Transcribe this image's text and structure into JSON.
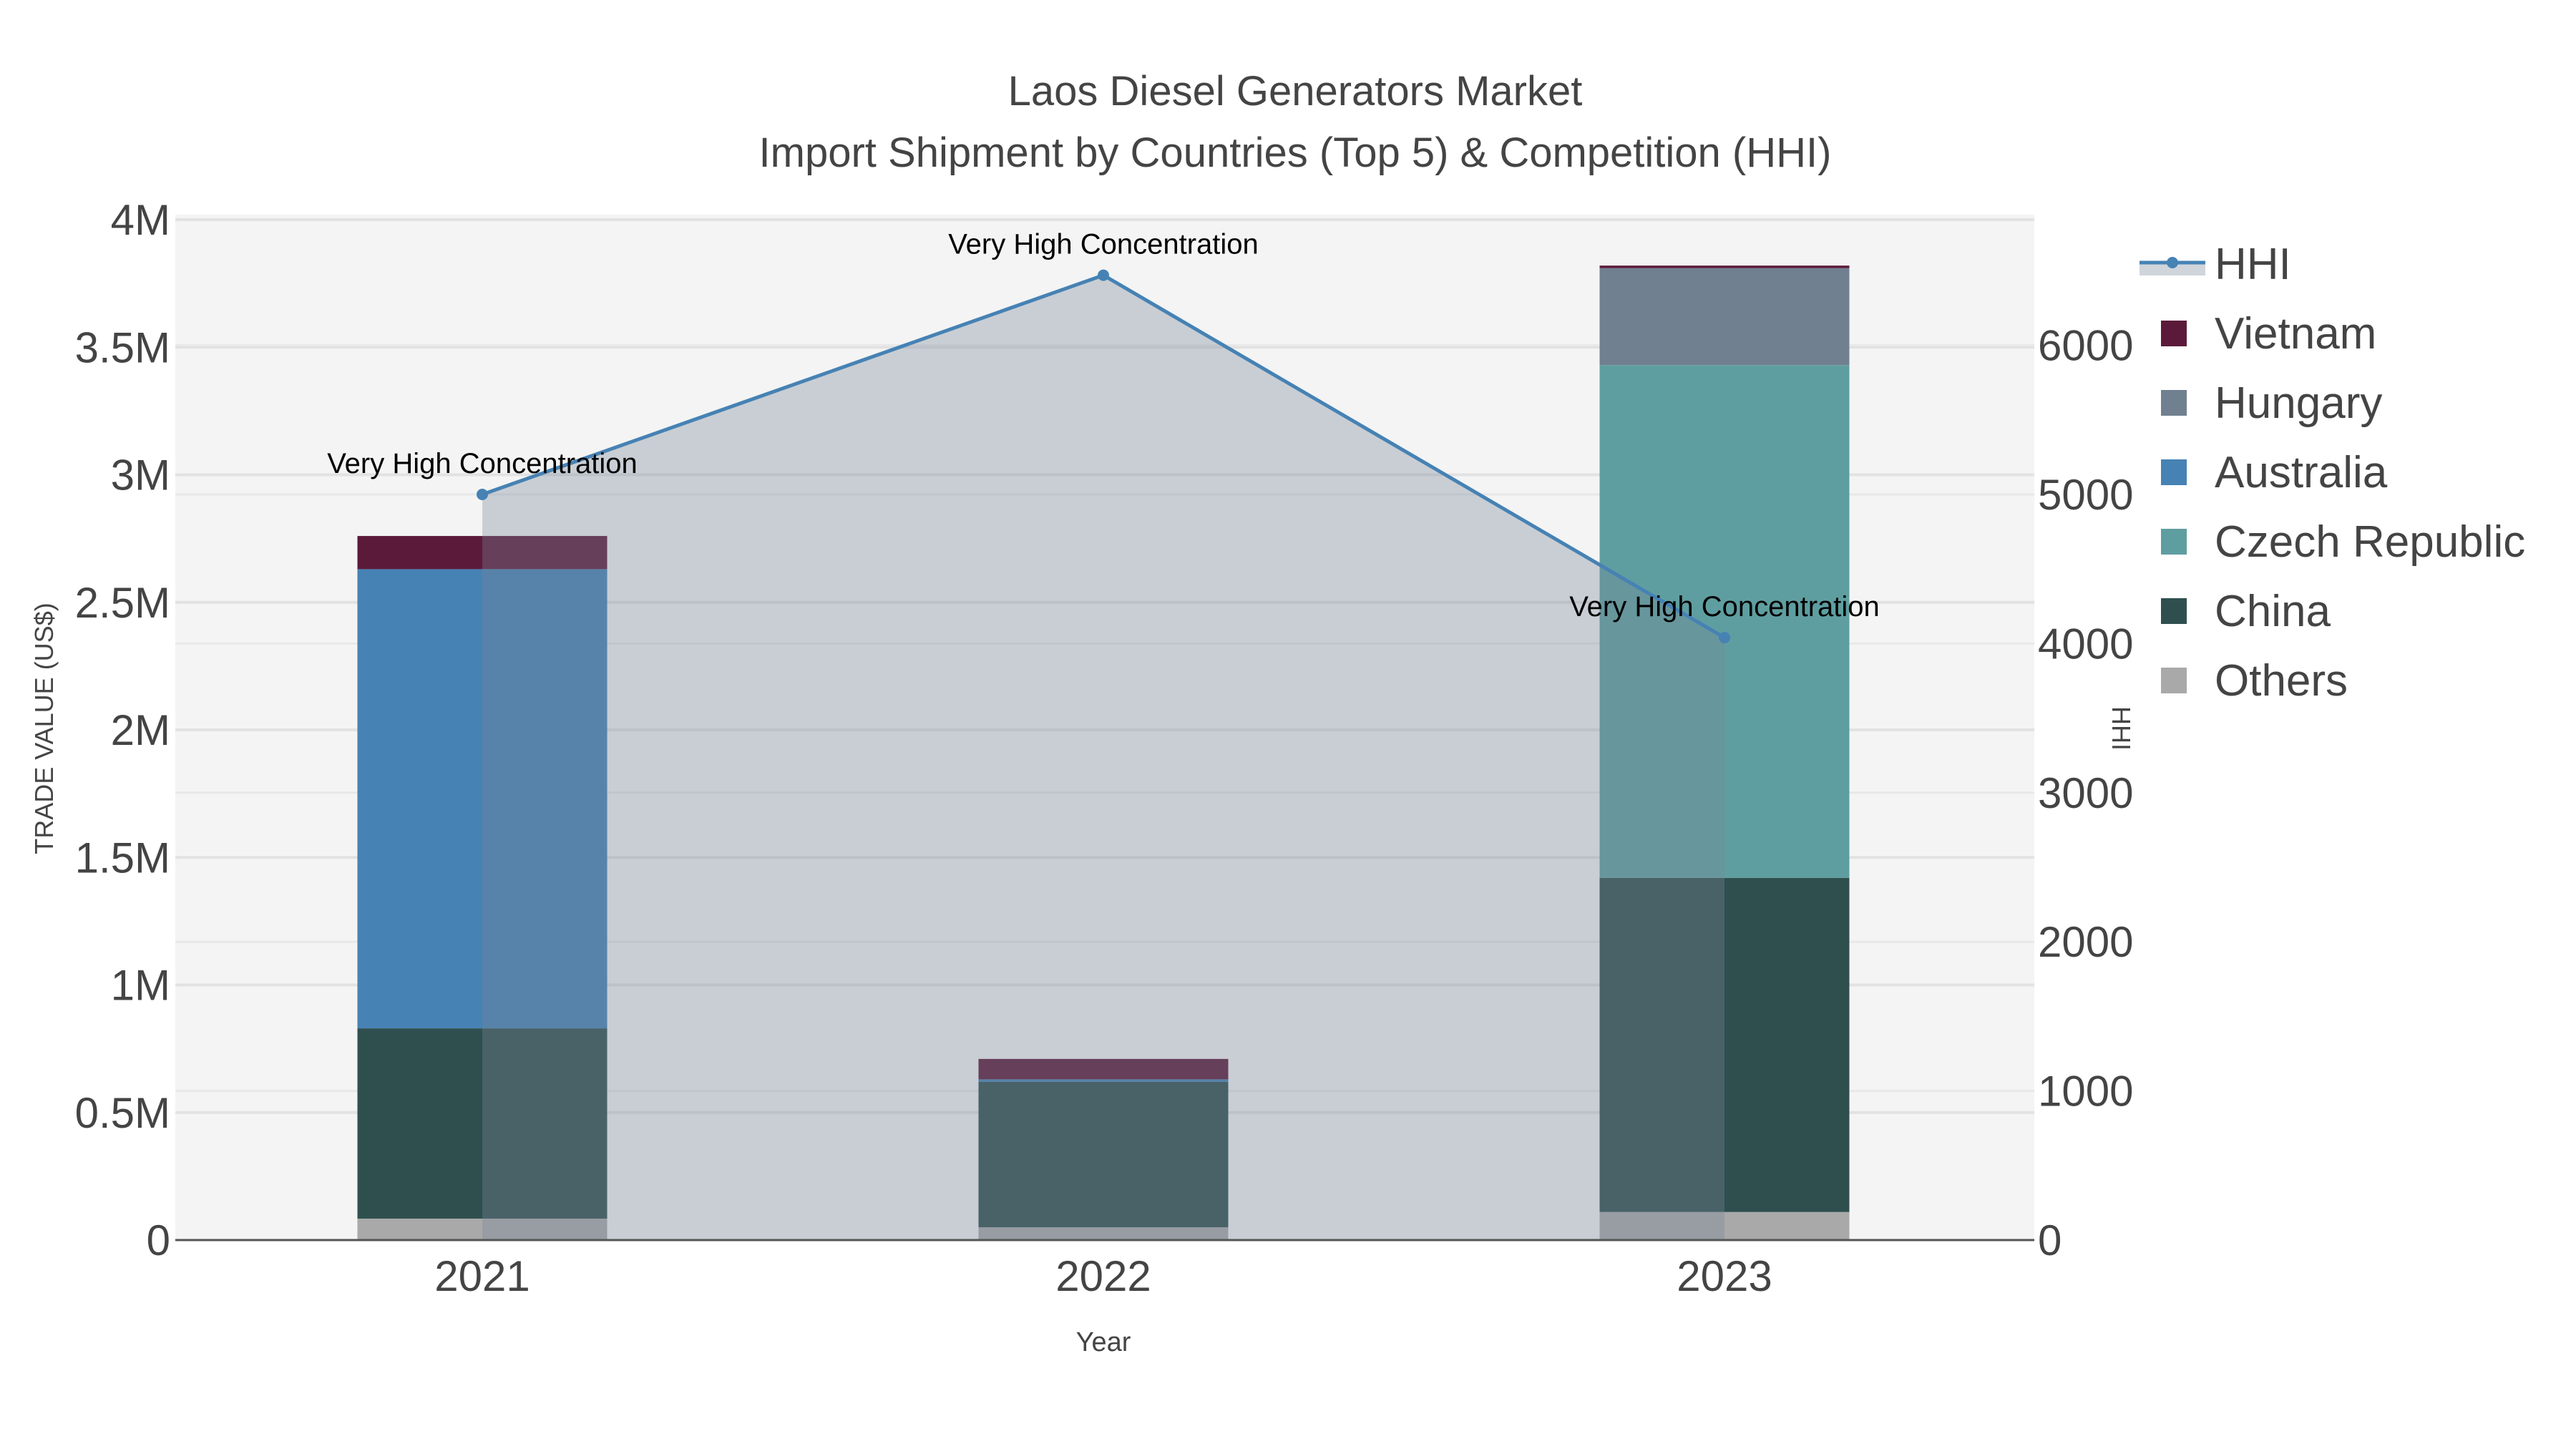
{
  "chart_data": {
    "type": "bar",
    "title": "Laos Diesel Generators Market",
    "subtitle": "Import Shipment by Countries (Top 5) & Competition (HHI)",
    "xlabel": "Year",
    "ylabel": "TRADE VALUE (US$)",
    "y2label": "HHI",
    "categories": [
      "2021",
      "2022",
      "2023"
    ],
    "ylim": [
      0,
      4000000
    ],
    "y2lim": [
      0,
      6850
    ],
    "yticks": [
      {
        "v": 0,
        "label": "0"
      },
      {
        "v": 500000,
        "label": "0.5M"
      },
      {
        "v": 1000000,
        "label": "1M"
      },
      {
        "v": 1500000,
        "label": "1.5M"
      },
      {
        "v": 2000000,
        "label": "2M"
      },
      {
        "v": 2500000,
        "label": "2.5M"
      },
      {
        "v": 3000000,
        "label": "3M"
      },
      {
        "v": 3500000,
        "label": "3.5M"
      },
      {
        "v": 4000000,
        "label": "4M"
      }
    ],
    "y2ticks": [
      {
        "v": 0,
        "label": "0"
      },
      {
        "v": 1000,
        "label": "1000"
      },
      {
        "v": 2000,
        "label": "2000"
      },
      {
        "v": 3000,
        "label": "3000"
      },
      {
        "v": 4000,
        "label": "4000"
      },
      {
        "v": 5000,
        "label": "5000"
      },
      {
        "v": 6000,
        "label": "6000"
      }
    ],
    "stacked": true,
    "series": [
      {
        "name": "Others",
        "color": "#a9a9a9",
        "values": [
          84000,
          50000,
          110000
        ]
      },
      {
        "name": "China",
        "color": "#2f4f4f",
        "values": [
          746000,
          570000,
          1310000
        ]
      },
      {
        "name": "Czech Republic",
        "color": "#5f9ea0",
        "values": [
          0,
          0,
          2010000
        ]
      },
      {
        "name": "Australia",
        "color": "#4682b4",
        "values": [
          1800000,
          10000,
          0
        ]
      },
      {
        "name": "Hungary",
        "color": "#708090",
        "values": [
          0,
          0,
          380000
        ]
      },
      {
        "name": "Vietnam",
        "color": "#5c1a3a",
        "values": [
          130000,
          80000,
          10000
        ]
      }
    ],
    "hhi": {
      "name": "HHI",
      "color": "#4682b4",
      "fill": "rgba(119,136,153,0.35)",
      "values": [
        5000,
        6470,
        4040
      ]
    },
    "annotations": [
      "Very High Concentration",
      "Very High Concentration",
      "Very High Concentration"
    ],
    "legend": {
      "placement": "right",
      "order": [
        "HHI",
        "Vietnam",
        "Hungary",
        "Australia",
        "Czech Republic",
        "China",
        "Others"
      ]
    },
    "grid": true
  }
}
